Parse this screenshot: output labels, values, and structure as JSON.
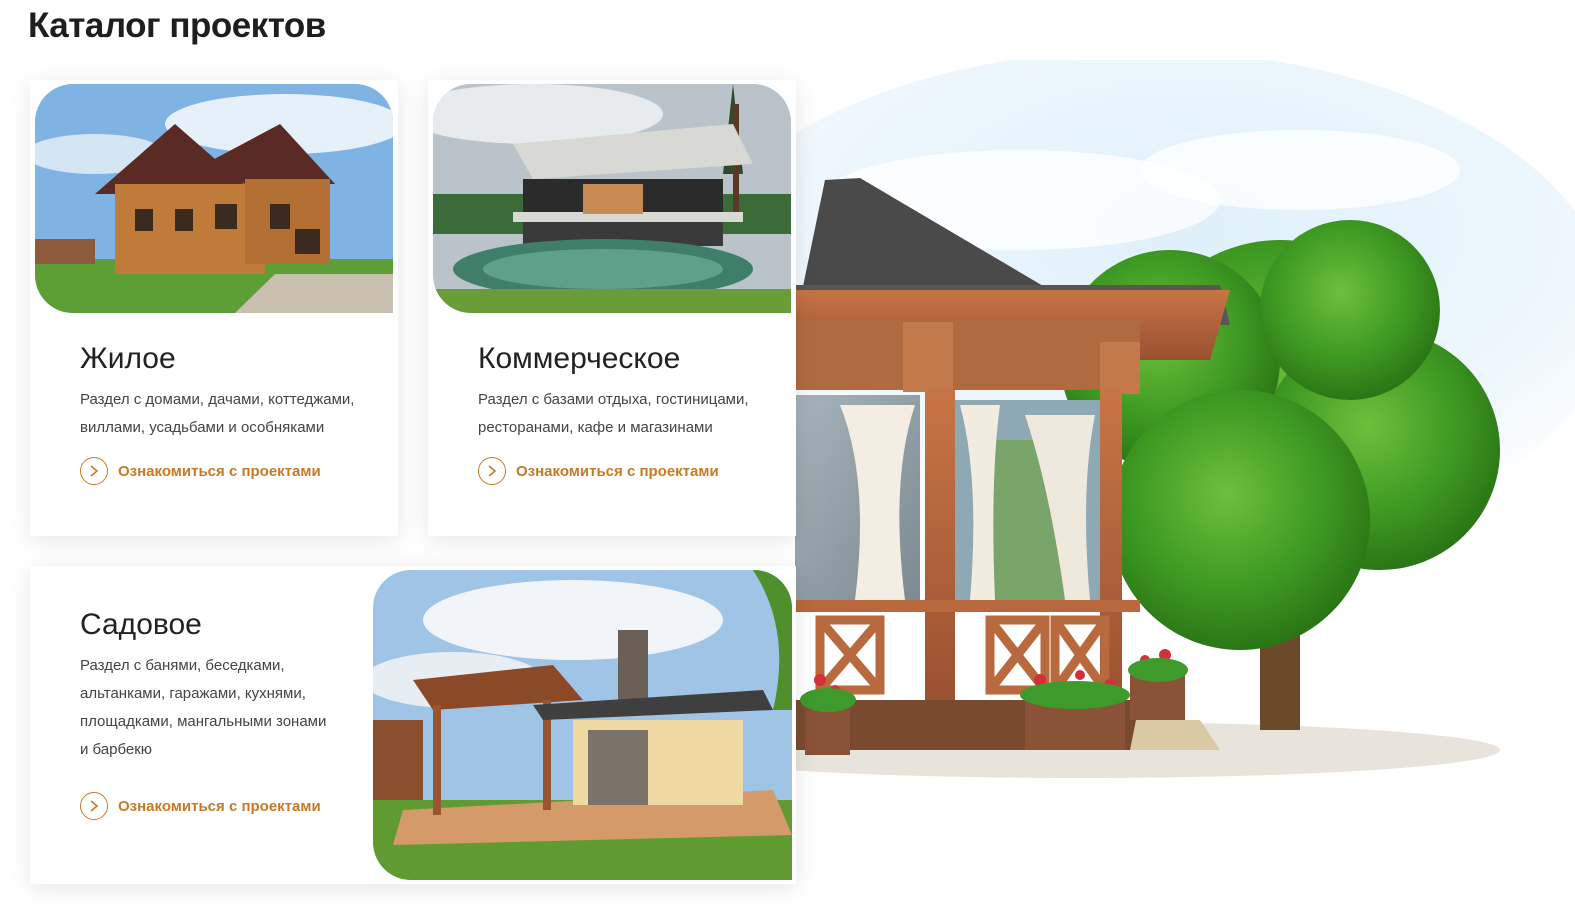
{
  "page": {
    "title": "Каталог проектов"
  },
  "cards": [
    {
      "title": "Жилое",
      "description": "Раздел с домами, дачами, коттеджами, виллами, усадьбами и особняками",
      "link": "Ознакомиться с проектами",
      "image": "wooden-house-photo"
    },
    {
      "title": "Коммерческое",
      "description": "Раздел с базами отдыха, гостиницами, ресторанами, кафе и магазинами",
      "link": "Ознакомиться с проектами",
      "image": "modern-villa-pool-photo"
    },
    {
      "title": "Садовое",
      "description": "Раздел с банями, беседками, альтанками, гаражами, кухнями, площадками, мангальными зонами и барбекю",
      "link": "Ознакомиться с проектами",
      "image": "garden-pavilion-photo"
    }
  ],
  "icons": {
    "link": "chevron-right-circle-icon"
  },
  "colors": {
    "accent": "#c77a26",
    "title": "#1e1e1e"
  }
}
